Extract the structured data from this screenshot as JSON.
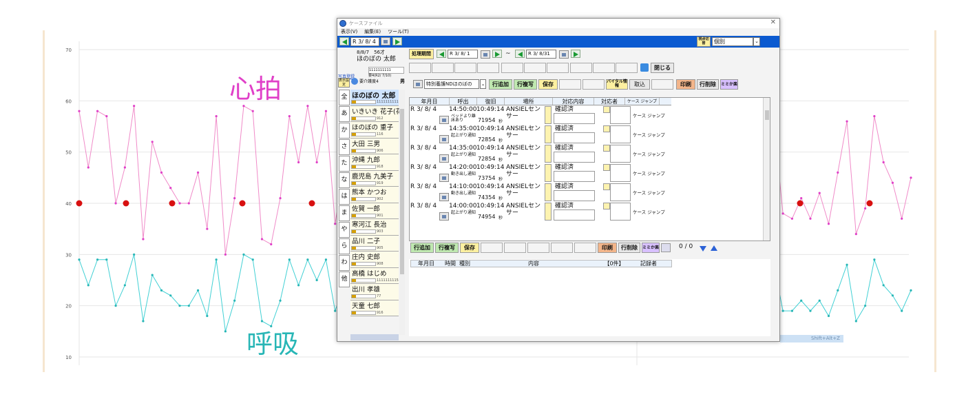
{
  "background": {
    "heart_rate_label": "心拍",
    "respiration_label": "呼吸",
    "y_ticks": [
      "70",
      "60",
      "50",
      "40",
      "30",
      "20",
      "10"
    ],
    "shortcut_hint": "Shift+Alt+Z",
    "hr_color": "#e040c8",
    "resp_color": "#28b6b6",
    "chart_data": {
      "type": "line",
      "ylim": [
        10,
        70
      ],
      "series": [
        {
          "values": [
            58,
            47,
            58,
            57,
            40,
            47,
            59,
            33,
            52,
            46,
            43,
            40,
            40,
            46,
            35,
            57,
            30,
            41,
            59,
            58,
            33,
            32,
            41,
            57,
            48,
            59,
            48,
            58,
            36,
            47,
            52,
            32,
            36,
            49,
            32,
            48,
            32,
            49,
            46,
            36,
            50,
            47,
            36,
            49,
            42,
            52,
            39,
            54,
            42,
            42,
            37,
            33,
            36,
            54,
            48,
            36,
            55,
            47,
            52,
            40,
            57,
            49,
            38,
            37,
            46,
            54,
            42,
            35,
            47,
            38,
            36,
            60,
            33,
            50,
            35,
            39,
            56,
            38,
            37,
            41,
            37,
            42,
            36,
            46,
            56,
            34,
            39,
            57,
            48,
            44,
            37,
            45
          ]
        },
        {
          "values": [
            29,
            24,
            29,
            29,
            20,
            24,
            30,
            17,
            26,
            23,
            22,
            20,
            20,
            23,
            18,
            29,
            15,
            21,
            30,
            29,
            17,
            16,
            21,
            29,
            24,
            29,
            25,
            29,
            19,
            24,
            26,
            16,
            19,
            25,
            16,
            24,
            17,
            25,
            23,
            18,
            25,
            24,
            18,
            25,
            21,
            26,
            20,
            28,
            21,
            21,
            19,
            17,
            18,
            28,
            24,
            19,
            28,
            24,
            26,
            20,
            29,
            25,
            19,
            19,
            23,
            28,
            21,
            18,
            24,
            19,
            18,
            30,
            17,
            25,
            18,
            20,
            28,
            19,
            19,
            21,
            19,
            21,
            18,
            23,
            28,
            17,
            20,
            29,
            24,
            22,
            19,
            23
          ]
        }
      ]
    }
  },
  "window": {
    "title": "ケースファイル",
    "menu": [
      "表示(V)",
      "編集(E)",
      "ツール(T)"
    ],
    "date": "R 3/ 8/ 4",
    "view_switch_label": "視点切替",
    "view_value": "個別",
    "profile": {
      "line1": "8/8/7　56才",
      "name": "ほのぼの 太郎",
      "photo_label": "写真登録",
      "code": "1111111111",
      "care": "要介護度4",
      "period": "要4(R2/ 7/10)",
      "sex": "男",
      "settings_label": "表示設定"
    },
    "period_label": "処理期間",
    "period_from": "R 3/ 8/ 1",
    "period_to": "R 3/ 8/31",
    "tilde": "~",
    "close_label": "閉じる",
    "toolbar": {
      "service": "特別養護NDほのぼの",
      "add": "行追加",
      "copy": "行複写",
      "save": "保存",
      "vital": "バイタル情報",
      "import": "取込",
      "print": "印刷",
      "delete": "行削除",
      "mimamori": "ミミか楽"
    },
    "kana": [
      "全",
      "あ",
      "か",
      "さ",
      "た",
      "な",
      "は",
      "ま",
      "や",
      "ら",
      "わ",
      "他"
    ],
    "residents": [
      {
        "name": "ほのぼの 太郎",
        "code": "1111111111"
      },
      {
        "name": "いきいき 花子(花)",
        "code": "912"
      },
      {
        "name": "ほのぼの 重子",
        "code": "116"
      },
      {
        "name": "大田 三男",
        "code": "906"
      },
      {
        "name": "沖縄 九郎",
        "code": "918"
      },
      {
        "name": "鹿児島 九美子",
        "code": "919"
      },
      {
        "name": "熊本 かつお",
        "code": "902"
      },
      {
        "name": "佐賀 一郎",
        "code": "901"
      },
      {
        "name": "寒河江 長治",
        "code": "903"
      },
      {
        "name": "品川 二子",
        "code": "905"
      },
      {
        "name": "庄内 史郎",
        "code": "908"
      },
      {
        "name": "高橋 はじめ",
        "code": "1111111115"
      },
      {
        "name": "出川 孝雄",
        "code": "77"
      },
      {
        "name": "天童 七郎",
        "code": "916"
      }
    ],
    "grid": {
      "headers": [
        "年月日",
        "呼出",
        "復旧",
        "場所",
        "対応内容",
        "対応者",
        "ケース ジャンプ"
      ],
      "rows": [
        {
          "date": "R 3/ 8/ 4",
          "call": "14:50:00",
          "recover": "10:49:14",
          "place": "ANSIELセンサー",
          "reason": "ベッドより離床あり",
          "code": "71954",
          "status": "確認済",
          "case": "ケース ジャンプ"
        },
        {
          "date": "R 3/ 8/ 4",
          "call": "14:35:00",
          "recover": "10:49:14",
          "place": "ANSIELセンサー",
          "reason": "起上がり通知",
          "code": "72854",
          "status": "確認済",
          "case": "ケース ジャンプ"
        },
        {
          "date": "R 3/ 8/ 4",
          "call": "14:35:00",
          "recover": "10:49:14",
          "place": "ANSIELセンサー",
          "reason": "起上がり通知",
          "code": "72854",
          "status": "確認済",
          "case": "ケース ジャンプ"
        },
        {
          "date": "R 3/ 8/ 4",
          "call": "14:20:00",
          "recover": "10:49:14",
          "place": "ANSIELセンサー",
          "reason": "動き出し通知",
          "code": "73754",
          "status": "確認済",
          "case": "ケース ジャンプ"
        },
        {
          "date": "R 3/ 8/ 4",
          "call": "14:10:00",
          "recover": "10:49:14",
          "place": "ANSIELセンサー",
          "reason": "動き出し通知",
          "code": "74354",
          "status": "確認済",
          "case": "ケース ジャンプ"
        },
        {
          "date": "R 3/ 8/ 4",
          "call": "14:00:00",
          "recover": "10:49:14",
          "place": "ANSIELセンサー",
          "reason": "起上がり通知",
          "code": "74954",
          "status": "確認済",
          "case": "ケース ジャンプ"
        }
      ],
      "unit": "秒"
    },
    "lower": {
      "add": "行追加",
      "copy": "行複写",
      "save": "保存",
      "print": "印刷",
      "delete": "行削除",
      "mimamori": "ミミか楽",
      "paging": "0 / 0",
      "headers": [
        "年月日",
        "時間",
        "種別",
        "内容",
        "【0件】",
        "記録者"
      ]
    }
  }
}
